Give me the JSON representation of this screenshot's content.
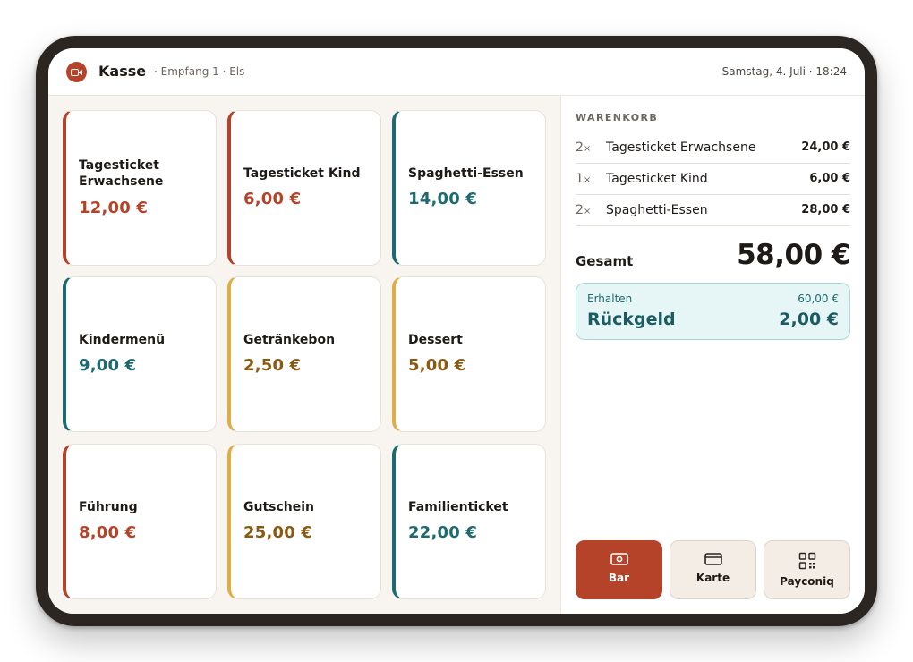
{
  "header": {
    "app_title": "Kasse",
    "subtitle": "· Empfang 1 · Els",
    "datetime": "Samstag, 4. Juli · 18:24"
  },
  "colors": {
    "red": "#b5432a",
    "teal": "#1d6a70",
    "gold": "#e0ad45",
    "brown": "#8a5a12"
  },
  "products": [
    {
      "name": "Tagesticket Erwachsene",
      "price": "12,00 €",
      "accent": "red"
    },
    {
      "name": "Tagesticket Kind",
      "price": "6,00 €",
      "accent": "red"
    },
    {
      "name": "Spaghetti-Essen",
      "price": "14,00 €",
      "accent": "teal"
    },
    {
      "name": "Kindermenü",
      "price": "9,00 €",
      "accent": "teal"
    },
    {
      "name": "Getränkebon",
      "price": "2,50 €",
      "accent": "gold"
    },
    {
      "name": "Dessert",
      "price": "5,00 €",
      "accent": "gold"
    },
    {
      "name": "Führung",
      "price": "8,00 €",
      "accent": "red"
    },
    {
      "name": "Gutschein",
      "price": "25,00 €",
      "accent": "gold"
    },
    {
      "name": "Familienticket",
      "price": "22,00 €",
      "accent": "teal"
    }
  ],
  "cart": {
    "heading": "WARENKORB",
    "items": [
      {
        "qty": "2",
        "name": "Tagesticket Erwachsene",
        "total": "24,00 €"
      },
      {
        "qty": "1",
        "name": "Tagesticket Kind",
        "total": "6,00 €"
      },
      {
        "qty": "2",
        "name": "Spaghetti-Essen",
        "total": "28,00 €"
      }
    ],
    "qty_suffix": "×",
    "total_label": "Gesamt",
    "total_value": "58,00 €",
    "received_label": "Erhalten",
    "received_value": "60,00 €",
    "change_label": "Rückgeld",
    "change_value": "2,00 €"
  },
  "payment": {
    "methods": [
      {
        "label": "Bar",
        "icon": "cash-icon",
        "active": true
      },
      {
        "label": "Karte",
        "icon": "card-icon",
        "active": false
      },
      {
        "label": "Payconiq",
        "icon": "qr-code-icon",
        "active": false
      }
    ]
  }
}
